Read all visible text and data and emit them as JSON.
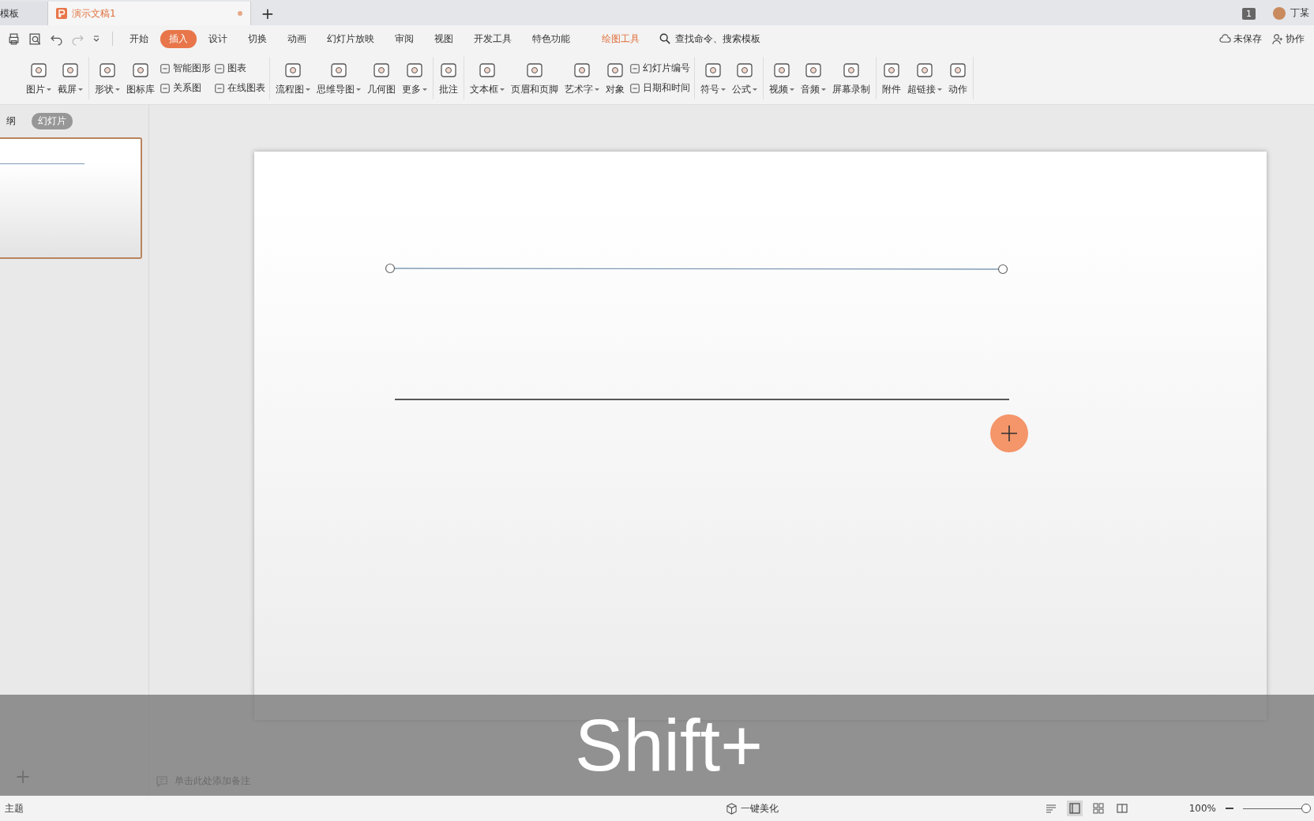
{
  "doc_tabs": [
    {
      "label": "模板",
      "selected": false,
      "unsaved": false
    },
    {
      "label": "演示文稿1",
      "selected": true,
      "unsaved": true
    }
  ],
  "new_tab": "+",
  "account": {
    "badge": "1",
    "user": "丁某"
  },
  "menu": [
    {
      "label": "开始",
      "selected": false,
      "kind": "tab"
    },
    {
      "label": "插入",
      "selected": true,
      "kind": "tab"
    },
    {
      "label": "设计",
      "selected": false,
      "kind": "tab"
    },
    {
      "label": "切换",
      "selected": false,
      "kind": "tab"
    },
    {
      "label": "动画",
      "selected": false,
      "kind": "tab"
    },
    {
      "label": "幻灯片放映",
      "selected": false,
      "kind": "tab"
    },
    {
      "label": "审阅",
      "selected": false,
      "kind": "tab"
    },
    {
      "label": "视图",
      "selected": false,
      "kind": "tab"
    },
    {
      "label": "开发工具",
      "selected": false,
      "kind": "tab"
    },
    {
      "label": "特色功能",
      "selected": false,
      "kind": "tab"
    },
    {
      "label": "绘图工具",
      "selected": false,
      "kind": "context"
    }
  ],
  "search": {
    "placeholder": "查找命令、搜索模板"
  },
  "top_actions": [
    "未保存",
    "协作"
  ],
  "ribbon": [
    [
      {
        "kind": "big",
        "label": "图片",
        "dropdown": true
      },
      {
        "kind": "big",
        "label": "截屏",
        "dropdown": true
      }
    ],
    [
      {
        "kind": "big",
        "label": "形状",
        "dropdown": true
      },
      {
        "kind": "big",
        "label": "图标库",
        "dropdown": false
      },
      {
        "kind": "pair",
        "items": [
          "智能图形",
          "关系图"
        ]
      },
      {
        "kind": "pair",
        "items": [
          "图表",
          "在线图表"
        ]
      }
    ],
    [
      {
        "kind": "big",
        "label": "流程图",
        "dropdown": true
      },
      {
        "kind": "big",
        "label": "思维导图",
        "dropdown": true
      },
      {
        "kind": "big",
        "label": "几何图",
        "dropdown": false
      },
      {
        "kind": "big",
        "label": "更多",
        "dropdown": true
      }
    ],
    [
      {
        "kind": "big",
        "label": "批注",
        "dropdown": false
      }
    ],
    [
      {
        "kind": "big",
        "label": "文本框",
        "dropdown": true
      },
      {
        "kind": "big",
        "label": "页眉和页脚",
        "dropdown": false
      },
      {
        "kind": "big",
        "label": "艺术字",
        "dropdown": true
      },
      {
        "kind": "big",
        "label": "对象",
        "dropdown": false
      },
      {
        "kind": "pair",
        "items": [
          "幻灯片编号",
          "日期和时间"
        ]
      }
    ],
    [
      {
        "kind": "big",
        "label": "符号",
        "dropdown": true
      },
      {
        "kind": "big",
        "label": "公式",
        "dropdown": true
      }
    ],
    [
      {
        "kind": "big",
        "label": "视频",
        "dropdown": true
      },
      {
        "kind": "big",
        "label": "音频",
        "dropdown": true
      },
      {
        "kind": "big",
        "label": "屏幕录制",
        "dropdown": false
      }
    ],
    [
      {
        "kind": "big",
        "label": "附件",
        "dropdown": false
      },
      {
        "kind": "big",
        "label": "超链接",
        "dropdown": true
      },
      {
        "kind": "big",
        "label": "动作",
        "dropdown": false
      }
    ]
  ],
  "panel_tabs": [
    {
      "label": "纲",
      "selected": false
    },
    {
      "label": "幻灯片",
      "selected": true
    }
  ],
  "thumbnails": [
    {
      "selected": true
    }
  ],
  "add_slide": "+",
  "notes": {
    "placeholder": "单击此处添加备注"
  },
  "caption": "Shift+",
  "status_bar": {
    "theme": "主题",
    "beautify": "一键美化",
    "zoom": "100%",
    "zoom_slider": {
      "level": 1
    }
  }
}
